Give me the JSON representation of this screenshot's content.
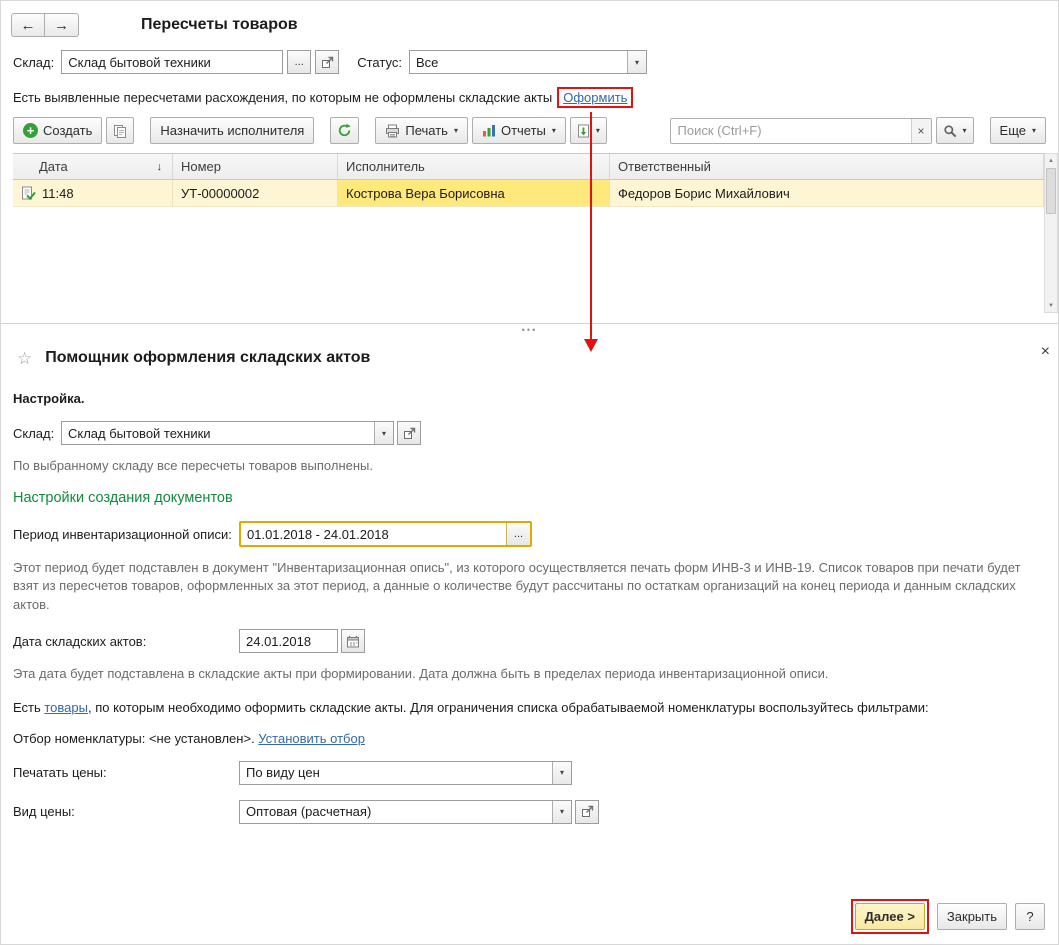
{
  "colors": {
    "annotation": "#e01212",
    "field_highlight": "#e3a900",
    "row_highlight": "#fdf5d3",
    "cell_highlight": "#ffe87c",
    "heading_green": "#128a3e",
    "link": "#3269a8"
  },
  "glyphs": {
    "back": "←",
    "forward": "→",
    "caret": "▾",
    "ellipsis": "...",
    "close": "×",
    "clear": "×",
    "star": "☆",
    "plus": "+",
    "sort_desc": "↓",
    "splitter_dots": "•••",
    "scroll_up": "▲",
    "scroll_down": "▼",
    "help": "?"
  },
  "list_window": {
    "title": "Пересчеты товаров",
    "filters": {
      "warehouse_label": "Склад:",
      "warehouse_value": "Склад бытовой техники",
      "status_label": "Статус:",
      "status_value": "Все"
    },
    "notice_text": "Есть выявленные пересчетами расхождения, по которым не оформлены складские акты",
    "notice_link": "Оформить",
    "toolbar": {
      "create_label": "Создать",
      "assign_label": "Назначить исполнителя",
      "print_label": "Печать",
      "reports_label": "Отчеты",
      "search_placeholder": "Поиск (Ctrl+F)",
      "more_label": "Еще"
    },
    "table": {
      "columns": [
        "Дата",
        "Номер",
        "Исполнитель",
        "Ответственный"
      ],
      "rows": [
        {
          "time": "11:48",
          "number": "УТ-00000002",
          "executor": "Кострова Вера Борисовна",
          "responsible": "Федоров Борис Михайлович"
        }
      ]
    }
  },
  "wizard": {
    "title": "Помощник оформления складских актов",
    "setup_heading": "Настройка.",
    "warehouse_label": "Склад:",
    "warehouse_value": "Склад бытовой техники",
    "warehouse_note": "По выбранному складу все пересчеты товаров выполнены.",
    "documents_heading": "Настройки создания документов",
    "period_label": "Период инвентаризационной описи:",
    "period_value": "01.01.2018 - 24.01.2018",
    "period_note": "Этот период будет подставлен в документ \"Инвентаризационная опись\", из которого осуществляется печать форм ИНВ-3 и ИНВ-19. Список товаров при печати будет взят из пересчетов товаров, оформленных за этот период, а данные о количестве будут рассчитаны по остаткам организаций на конец периода и данным складских актов.",
    "acts_date_label": "Дата складских актов:",
    "acts_date_value": "24.01.2018",
    "acts_date_note": "Эта дата будет подставлена в складские акты при формировании. Дата должна быть в пределах периода инвентаризационной описи.",
    "goods_before": "Есть ",
    "goods_link": "товары",
    "goods_after": ", по которым необходимо оформить складские акты. Для ограничения списка обрабатываемой номенклатуры воспользуйтесь фильтрами:",
    "selection_label": "Отбор номенклатуры: <не установлен>. ",
    "selection_link": "Установить отбор",
    "print_prices_label": "Печатать цены:",
    "print_prices_value": "По виду цен",
    "price_kind_label": "Вид цены:",
    "price_kind_value": "Оптовая (расчетная)",
    "next_label": "Далее >",
    "close_label": "Закрыть"
  }
}
